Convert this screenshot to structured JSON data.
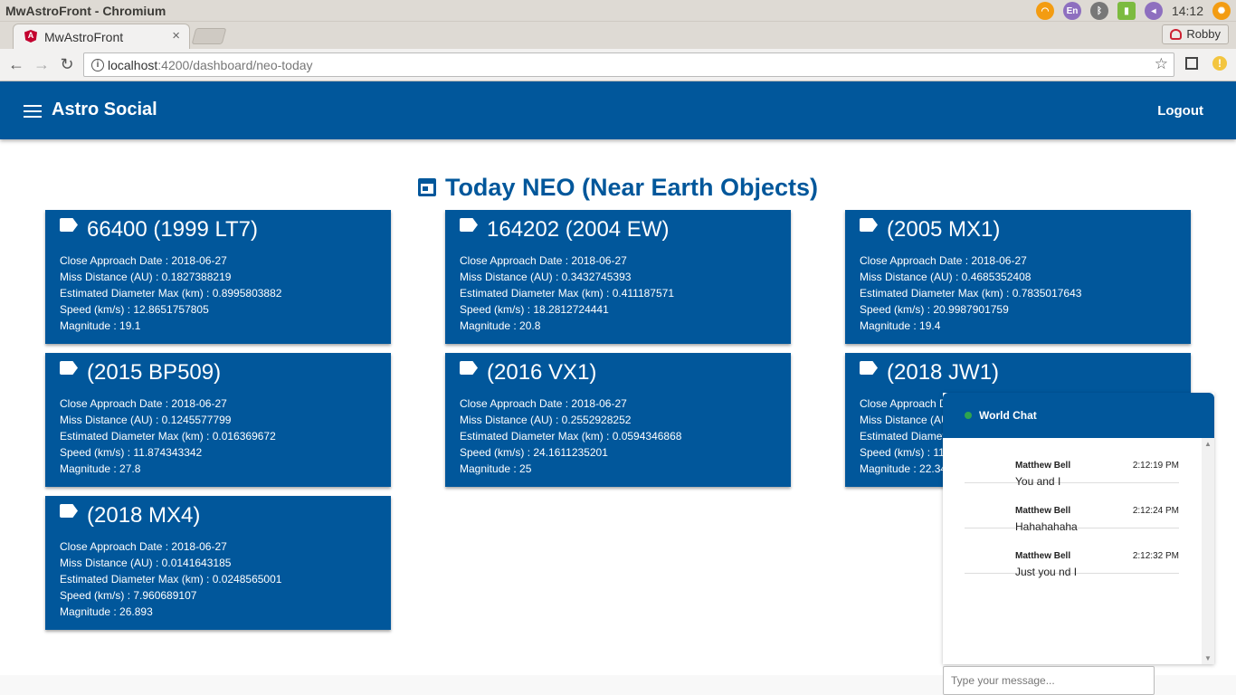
{
  "os": {
    "window_title": "MwAstroFront - Chromium",
    "lang": "En",
    "time": "14:12"
  },
  "browser": {
    "tab_label": "MwAstroFront",
    "tab_close": "×",
    "profile": "Robby",
    "url_host": "localhost",
    "url_rest": ":4200/dashboard/neo-today",
    "back": "←",
    "forward": "→",
    "reload": "↻",
    "star": "☆"
  },
  "app": {
    "brand": "Astro Social",
    "logout": "Logout"
  },
  "page": {
    "title": "Today NEO (Near Earth Objects)"
  },
  "neos": [
    {
      "name": "66400 (1999 LT7)",
      "date": "Close Approach Date : 2018-06-27",
      "miss": "Miss Distance (AU) : 0.1827388219",
      "diameter": "Estimated Diameter Max (km) : 0.8995803882",
      "speed": "Speed (km/s) : 12.8651757805",
      "magnitude": "Magnitude : 19.1"
    },
    {
      "name": "164202 (2004 EW)",
      "date": "Close Approach Date : 2018-06-27",
      "miss": "Miss Distance (AU) : 0.3432745393",
      "diameter": "Estimated Diameter Max (km) : 0.411187571",
      "speed": "Speed (km/s) : 18.2812724441",
      "magnitude": "Magnitude : 20.8"
    },
    {
      "name": "(2005 MX1)",
      "date": "Close Approach Date : 2018-06-27",
      "miss": "Miss Distance (AU) : 0.4685352408",
      "diameter": "Estimated Diameter Max (km) : 0.7835017643",
      "speed": "Speed (km/s) : 20.9987901759",
      "magnitude": "Magnitude : 19.4"
    },
    {
      "name": "(2015 BP509)",
      "date": "Close Approach Date : 2018-06-27",
      "miss": "Miss Distance (AU) : 0.1245577799",
      "diameter": "Estimated Diameter Max (km) : 0.016369672",
      "speed": "Speed (km/s) : 11.874343342",
      "magnitude": "Magnitude : 27.8"
    },
    {
      "name": "(2016 VX1)",
      "date": "Close Approach Date : 2018-06-27",
      "miss": "Miss Distance (AU) : 0.2552928252",
      "diameter": "Estimated Diameter Max (km) : 0.0594346868",
      "speed": "Speed (km/s) : 24.1611235201",
      "magnitude": "Magnitude : 25"
    },
    {
      "name": "(2018 JW1)",
      "date": "Close Approach D",
      "miss": "Miss Distance (AU",
      "diameter": "Estimated Diamete",
      "speed": "Speed (km/s) : 11",
      "magnitude": "Magnitude : 22.34"
    },
    {
      "name": "(2018 MX4)",
      "date": "Close Approach Date : 2018-06-27",
      "miss": "Miss Distance (AU) : 0.0141643185",
      "diameter": "Estimated Diameter Max (km) : 0.0248565001",
      "speed": "Speed (km/s) : 7.960689107",
      "magnitude": "Magnitude : 26.893"
    }
  ],
  "chat": {
    "title": "World Chat",
    "messages": [
      {
        "author": "Matthew Bell",
        "time": "2:12:19 PM",
        "text": "You and I"
      },
      {
        "author": "Matthew Bell",
        "time": "2:12:24 PM",
        "text": "Hahahahaha"
      },
      {
        "author": "Matthew Bell",
        "time": "2:12:32 PM",
        "text": "Just you nd I"
      }
    ],
    "placeholder": "Type your message..."
  },
  "colors": {
    "primary": "#01579b",
    "online": "#2ea44f"
  }
}
